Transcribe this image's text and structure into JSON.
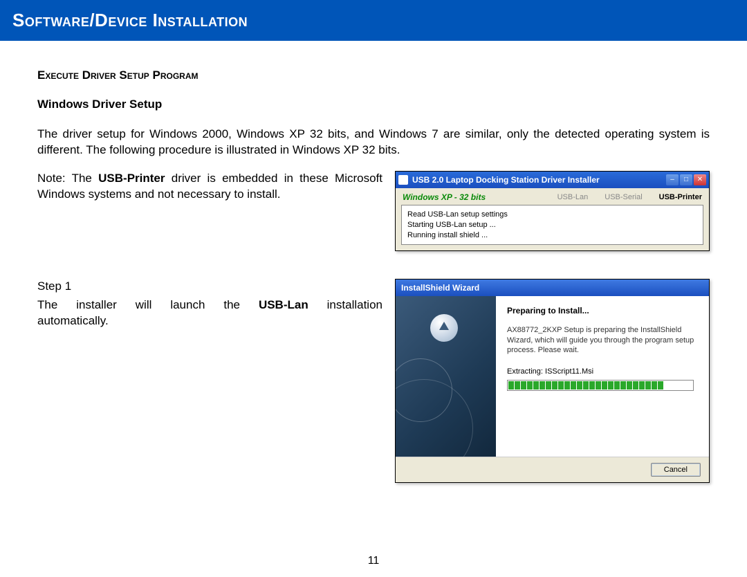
{
  "header": {
    "title": "Software/Device Installation"
  },
  "section": {
    "heading": "Execute Driver Setup Program",
    "subheading": "Windows Driver Setup",
    "intro": "The driver setup for Windows 2000, Windows XP 32 bits, and Windows 7 are similar, only the detected operating system is different.  The following procedure is illustrated in Windows XP 32 bits.",
    "note_pre": "Note: The ",
    "note_bold": "USB-Printer",
    "note_post": " driver is embedded in these Microsoft Windows systems and not necessary to install.",
    "step_label": "Step 1",
    "step_a": "The",
    "step_b": "installer",
    "step_c": "will",
    "step_d": "launch",
    "step_e": "the",
    "step_bold": "USB-Lan",
    "step_f": "installation",
    "step_tail": "automatically."
  },
  "dlg1": {
    "title": "USB 2.0 Laptop Docking Station Driver Installer",
    "os": "Windows XP - 32 bits",
    "tab_lan": "USB-Lan",
    "tab_serial": "USB-Serial",
    "tab_printer": "USB-Printer",
    "line1": "Read USB-Lan setup settings",
    "line2": "Starting USB-Lan setup ...",
    "line3": "Running install shield ..."
  },
  "dlg2": {
    "title": "InstallShield Wizard",
    "heading": "Preparing to Install...",
    "desc": "AX88772_2KXP Setup is preparing the InstallShield Wizard, which will guide you through the program setup process.  Please wait.",
    "extract": "Extracting: ISScript11.Msi",
    "cancel": "Cancel"
  },
  "page_number": "11"
}
